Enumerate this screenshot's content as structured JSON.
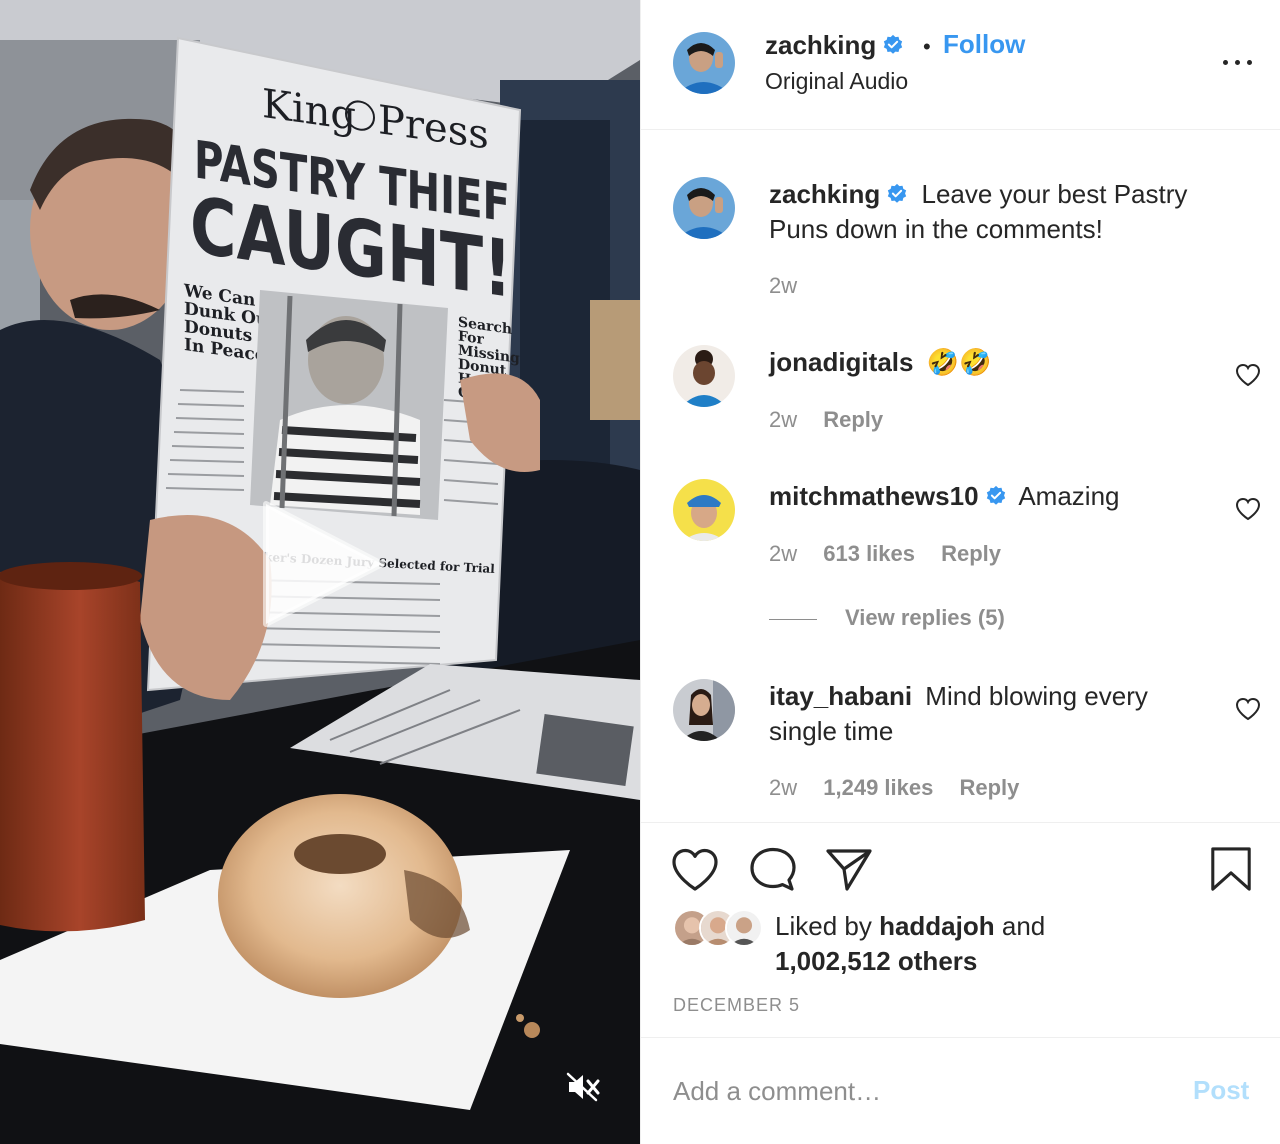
{
  "post": {
    "author": "zachking",
    "follow_label": "Follow",
    "separator": "•",
    "audio_label": "Original Audio"
  },
  "newspaper": {
    "masthead_left": "King",
    "masthead_right": "Press",
    "headline_1": "PASTRY THIEF",
    "headline_2": "CAUGHT!",
    "side_left": [
      "We Can",
      "Dunk Our",
      "Donuts",
      "In Peace"
    ],
    "side_right": [
      "Search",
      "For",
      "Missing",
      "Donut",
      "Holes",
      "Continues"
    ],
    "subhead": "Baker's Dozen Jury Selected for Trial"
  },
  "caption": {
    "username": "zachking",
    "text": "Leave your best Pastry Puns down in the comments!",
    "time": "2w"
  },
  "comments": [
    {
      "username": "jonadigitals",
      "verified": false,
      "text": "🤣🤣",
      "time": "2w",
      "likes": "",
      "reply_label": "Reply"
    },
    {
      "username": "mitchmathews10",
      "verified": true,
      "text": "Amazing",
      "time": "2w",
      "likes": "613 likes",
      "reply_label": "Reply",
      "view_replies": "View replies (5)"
    },
    {
      "username": "itay_habani",
      "verified": false,
      "text": "Mind blowing every single time",
      "time": "2w",
      "likes": "1,249 likes",
      "reply_label": "Reply"
    }
  ],
  "likes": {
    "prefix": "Liked by",
    "user": "haddajoh",
    "conjunction": "and",
    "others": "1,002,512 others"
  },
  "date": "DECEMBER 5",
  "add_comment": {
    "placeholder": "Add a comment…",
    "post_label": "Post"
  },
  "colors": {
    "link_blue": "#3897f0",
    "verified_blue": "#3897f0",
    "post_disabled": "#b2dffc",
    "muted_text": "#8e8e8e"
  },
  "icons": [
    "play-icon",
    "mute-icon",
    "verified-icon",
    "more-options-icon",
    "heart-icon",
    "comment-icon",
    "share-icon",
    "bookmark-icon"
  ]
}
